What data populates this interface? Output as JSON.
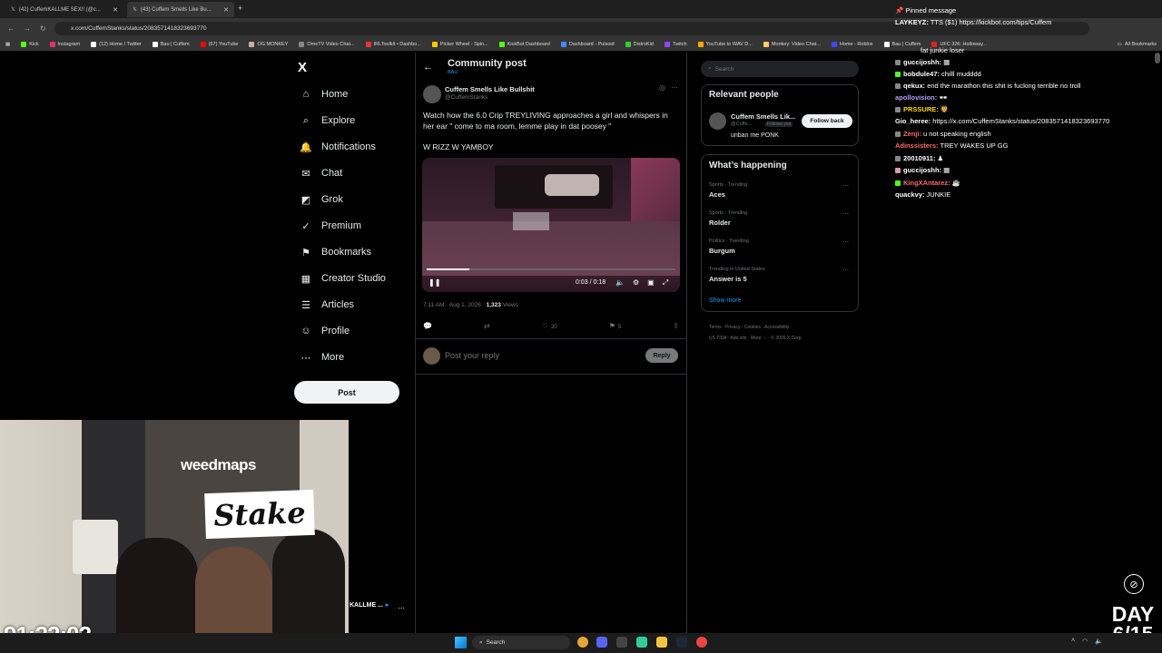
{
  "browser": {
    "tabs": [
      {
        "title": "(42) CuffemKALLME SEX!! (@c..."
      },
      {
        "title": "(43) Cuffem Smells Like Bu..."
      }
    ],
    "url": "x.com/CuffemStanks/status/2083571418323693770",
    "bookmarks": [
      "Kick",
      "Instagram",
      "(12) Home / Twitter",
      "Bau | Cuffem",
      "(57) YouTube",
      "OG MONKEY",
      "OmeTV Video Chat...",
      "IRLToolkit • Dashbo...",
      "Picker Wheel - Spin...",
      "KickBot Dashboard",
      "Dashboard - Pulsoid",
      "DistroKid",
      "Twitch",
      "YouTube to WAV D...",
      "Monkey: Video Chat...",
      "Home - Roblox",
      "Bau | Cuffem",
      "UFC 326: Holloway..."
    ],
    "all_bookmarks": "All Bookmarks",
    "new_tab": "+"
  },
  "nav": {
    "logo": "X",
    "items": [
      {
        "label": "Home",
        "icon": "⌂"
      },
      {
        "label": "Explore",
        "icon": "⌕"
      },
      {
        "label": "Notifications",
        "icon": "🔔"
      },
      {
        "label": "Chat",
        "icon": "✉"
      },
      {
        "label": "Grok",
        "icon": "◩"
      },
      {
        "label": "Premium",
        "icon": "✓"
      },
      {
        "label": "Bookmarks",
        "icon": "⚑"
      },
      {
        "label": "Creator Studio",
        "icon": "▦"
      },
      {
        "label": "Articles",
        "icon": "☰"
      },
      {
        "label": "Profile",
        "icon": "☺"
      },
      {
        "label": "More",
        "icon": "⋯"
      }
    ],
    "post_label": "Post"
  },
  "post": {
    "header_title": "Community post",
    "header_sub": "BAU",
    "author_name": "Cuffem Smells Like Bullshit",
    "author_handle": "@CuffemStanks",
    "text": "Watch how the 6.0 Crip TREYLIVING approaches a girl and whispers in her ear \" come to ma room, lemme play in dat poosey \"",
    "text2": "W RIZZ W YAMBOY",
    "video_time": "0:03 / 0:18",
    "video_progress": 0.17,
    "timestamp": "7:11 AM · Aug 1, 2026 · ",
    "views_count": "1,323",
    "views_label": " Views",
    "likes": "20",
    "bookmarks": "5",
    "reply_placeholder": "Post your reply",
    "reply_button": "Reply"
  },
  "sidebar": {
    "search_placeholder": "Search",
    "relevant_title": "Relevant people",
    "person_name": "Cuffem Smells Lik...",
    "person_handle": "@Cuffe...",
    "person_follows": "Follows you",
    "person_bio": "unban me PONK",
    "follow_label": "Follow back",
    "happening_title": "What’s happening",
    "trends": [
      {
        "category": "Sports · Trending",
        "name": "Aces"
      },
      {
        "category": "Sports · Trending",
        "name": "Rolder"
      },
      {
        "category": "Politics · Trending",
        "name": "Burgum"
      },
      {
        "category": "Trending in United States",
        "name": "Answer is 5"
      }
    ],
    "show_more": "Show more",
    "footer1": "Terms · Privacy · Cookies · Accessibility ·",
    "footer2": "US TIDA · Ads info · More ··· · © 2026 X Corp."
  },
  "chat": {
    "pinned": "Pinned message",
    "pinned_user": "LAYKEYZ:",
    "pinned_text": "TTS ($1) https://kickbot.com/tips/Cuffem",
    "messages": [
      {
        "user": "guccijoshh:",
        "text": "▦",
        "color": "#ffffff"
      },
      {
        "user": "bobdule47:",
        "text": "chilll mudddd",
        "color": "#ffffff"
      },
      {
        "user": "qekux:",
        "text": "end the marathon this shit is fucking terrible no troll",
        "color": "#ffffff"
      },
      {
        "user": "apollovision:",
        "text": "🕶",
        "color": "#b89cff"
      },
      {
        "user": "PRSSURE:",
        "text": "🦁",
        "color": "#ffd700"
      },
      {
        "user": "Gio_heree:",
        "text": "https://x.com/CuffemStanks/status/2083571418323693770",
        "color": "#ffffff"
      },
      {
        "user": "Zenji:",
        "text": "u not speaking english",
        "color": "#ff6a6a"
      },
      {
        "user": "Adinssisters:",
        "text": "TREY WAKES UP GG",
        "color": "#ff6a6a"
      },
      {
        "user": "20010911:",
        "text": "♟",
        "color": "#ffffff"
      },
      {
        "user": "guccijoshh:",
        "text": "▦",
        "color": "#ffffff"
      },
      {
        "user": "KingXAntarez:",
        "text": "☕",
        "color": "#ff6a6a"
      },
      {
        "user": "quackvy:",
        "text": "JUNKIE",
        "color": "#ffffff"
      }
    ],
    "top_partial": "fat junkie loser"
  },
  "stream": {
    "timer": "91:32:02",
    "kallme": "KALLME ...",
    "day_label": "DAY",
    "day_value": "6/15",
    "weedmaps": "weedmaps",
    "stake": "Stake"
  },
  "taskbar": {
    "search_label": "Search"
  }
}
